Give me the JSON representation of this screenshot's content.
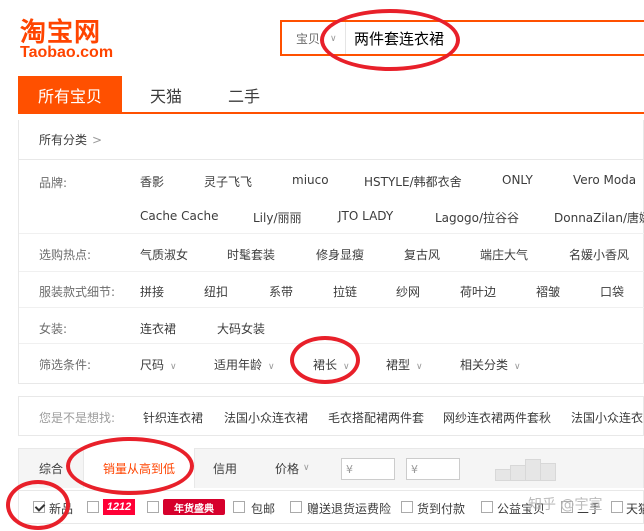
{
  "logo": {
    "main": "淘宝网",
    "sub": "Taobao.com"
  },
  "search": {
    "category": "宝贝",
    "query": "两件套连衣裙"
  },
  "tabs": [
    {
      "label": "所有宝贝",
      "active": true
    },
    {
      "label": "天猫",
      "active": false
    },
    {
      "label": "二手",
      "active": false
    }
  ],
  "crumb": {
    "label": "所有分类",
    "arrow": ">"
  },
  "filters": {
    "brand": {
      "label": "品牌:",
      "row1": [
        "香影",
        "灵子飞飞",
        "miuco",
        "HSTYLE/韩都衣舍",
        "ONLY",
        "Vero Moda"
      ],
      "row2": [
        "Cache Cache",
        "Lily/丽丽",
        "JTO LADY",
        "Lagogo/拉谷谷",
        "DonnaZilan/唐娜"
      ]
    },
    "hot": {
      "label": "选购热点:",
      "items": [
        "气质淑女",
        "时髦套装",
        "修身显瘦",
        "复古风",
        "端庄大气",
        "名媛小香风"
      ]
    },
    "detail": {
      "label": "服装款式细节:",
      "items": [
        "拼接",
        "纽扣",
        "系带",
        "拉链",
        "纱网",
        "荷叶边",
        "褶皱",
        "口袋"
      ]
    },
    "women": {
      "label": "女装:",
      "items": [
        "连衣裙",
        "大码女装"
      ]
    },
    "conditions": {
      "label": "筛选条件:",
      "items": [
        "尺码",
        "适用年龄",
        "裙长",
        "裙型",
        "相关分类"
      ]
    }
  },
  "suggest": {
    "label": "您是不是想找:",
    "items": [
      "针织连衣裙",
      "法国小众连衣裙",
      "毛衣搭配裙两件套",
      "网纱连衣裙两件套秋",
      "法国小众连衣"
    ]
  },
  "sortbar": {
    "items": [
      "综合",
      "销量从高到低",
      "信用",
      "价格"
    ],
    "price_from": "¥",
    "price_to": "¥",
    "dash": "-"
  },
  "checkboxes": {
    "new": "新品",
    "badge1212": "1212",
    "badgeNian": "年货盛典",
    "items": [
      "包邮",
      "赠送退货运费险",
      "货到付款",
      "公益宝贝",
      "二手",
      "天猫"
    ]
  },
  "watermark": "知乎 @宇宣",
  "colors": {
    "accent": "#ff5000",
    "annotation": "#e8202a"
  }
}
